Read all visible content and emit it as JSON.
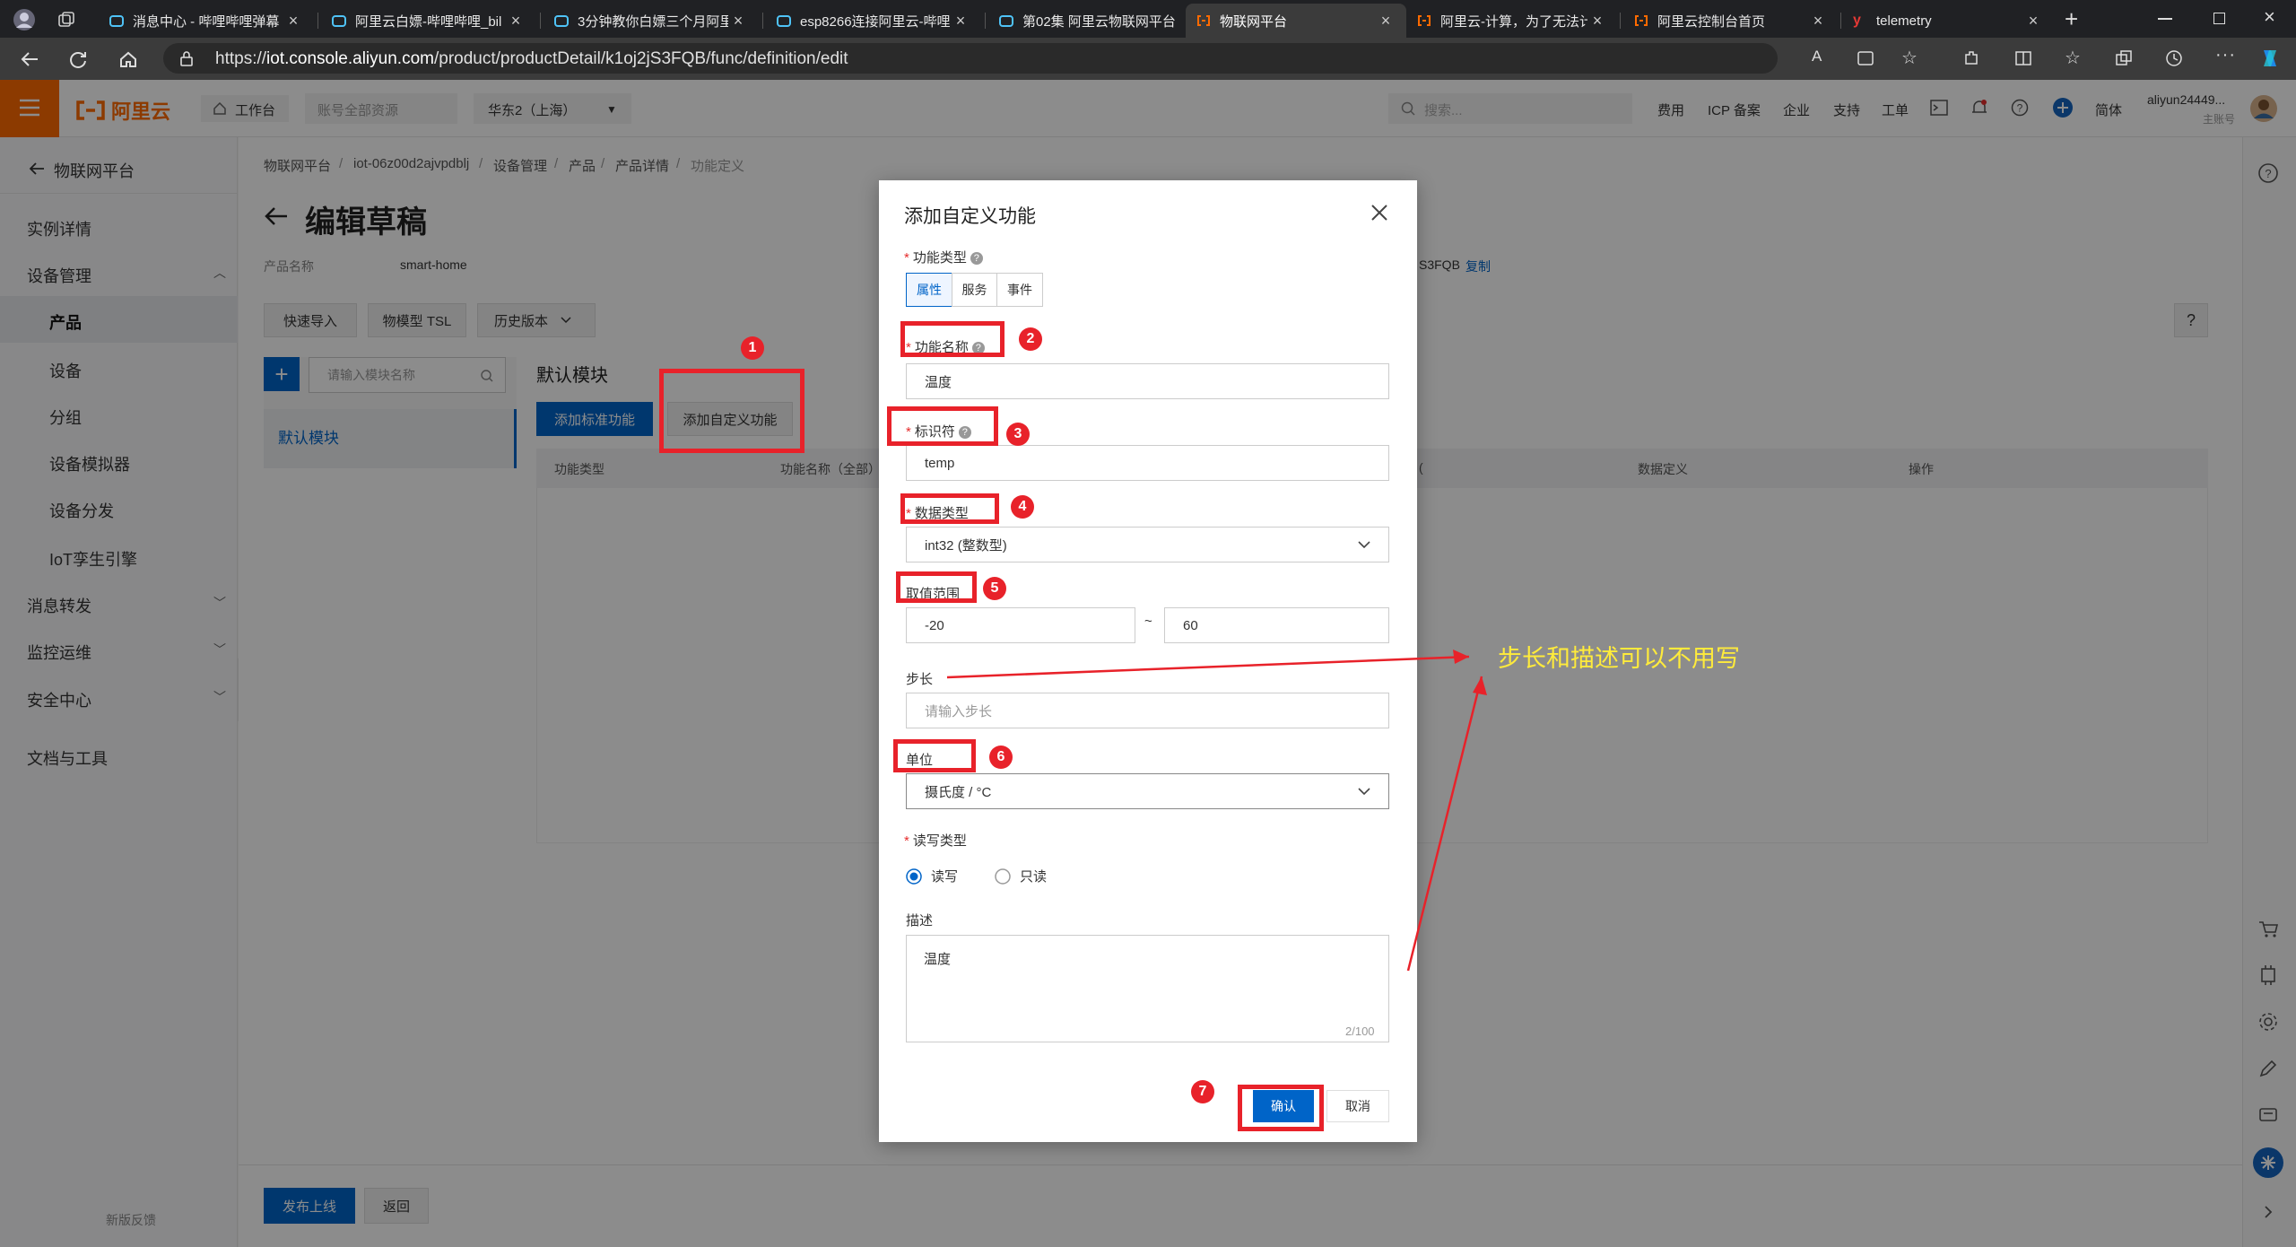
{
  "browser": {
    "tabs": [
      {
        "title": "消息中心 - 哔哩哔哩弹幕"
      },
      {
        "title": "阿里云白嫖-哔哩哔哩_bil"
      },
      {
        "title": "3分钟教你白嫖三个月阿里"
      },
      {
        "title": "esp8266连接阿里云-哔哩"
      },
      {
        "title": "第02集 阿里云物联网平台"
      },
      {
        "title": "物联网平台"
      },
      {
        "title": "阿里云-计算，为了无法计"
      },
      {
        "title": "阿里云控制台首页"
      },
      {
        "title": "telemetry"
      }
    ],
    "url_prefix": "https://",
    "url_host": "iot.console.aliyun.com",
    "url_path": "/product/productDetail/k1oj2jS3FQB/func/definition/edit"
  },
  "topnav": {
    "logo_text": "阿里云",
    "workbench": "工作台",
    "account_scope": "账号全部资源",
    "region": "华东2（上海）",
    "search_placeholder": "搜索...",
    "links": [
      "费用",
      "ICP 备案",
      "企业",
      "支持",
      "工单"
    ],
    "lang": "简体",
    "user_name": "aliyun24449...",
    "user_role": "主账号"
  },
  "sidebar": {
    "back_title": "物联网平台",
    "items": [
      {
        "label": "实例详情"
      },
      {
        "label": "设备管理"
      },
      {
        "label": "产品"
      },
      {
        "label": "设备"
      },
      {
        "label": "分组"
      },
      {
        "label": "设备模拟器"
      },
      {
        "label": "设备分发"
      },
      {
        "label": "IoT孪生引擎"
      },
      {
        "label": "消息转发"
      },
      {
        "label": "监控运维"
      },
      {
        "label": "安全中心"
      },
      {
        "label": "文档与工具"
      }
    ],
    "feedback": "新版反馈"
  },
  "breadcrumb": [
    "物联网平台",
    "iot-06z00d2ajvpdblj",
    "设备管理",
    "产品",
    "产品详情",
    "功能定义"
  ],
  "page": {
    "title": "编辑草稿",
    "product_name_label": "产品名称",
    "product_name_value": "smart-home",
    "product_key_partial": "S3FQB",
    "copy_link": "复制",
    "quick_import": "快速导入",
    "tsl_model": "物模型 TSL",
    "history_version": "历史版本",
    "module_search_placeholder": "请输入模块名称",
    "default_module_nav": "默认模块",
    "default_module_title": "默认模块",
    "add_standard": "添加标准功能",
    "add_custom": "添加自定义功能",
    "table_headers": [
      "功能类型",
      "功能名称（全部）",
      "数据定义",
      "操作"
    ],
    "table_header_partial": "(",
    "publish": "发布上线",
    "back": "返回",
    "help_mark": "?"
  },
  "modal": {
    "title": "添加自定义功能",
    "func_type_label": "功能类型",
    "func_types": [
      "属性",
      "服务",
      "事件"
    ],
    "selected_func_type": "属性",
    "func_name_label": "功能名称",
    "func_name_value": "温度",
    "identifier_label": "标识符",
    "identifier_value": "temp",
    "data_type_label": "数据类型",
    "data_type_value": "int32 (整数型)",
    "range_label": "取值范围",
    "range_min": "-20",
    "range_sep": "~",
    "range_max": "60",
    "step_label": "步长",
    "step_placeholder": "请输入步长",
    "unit_label": "单位",
    "unit_value": "摄氏度 / °C",
    "rw_label": "读写类型",
    "rw_options": [
      "读写",
      "只读"
    ],
    "rw_selected": "读写",
    "desc_label": "描述",
    "desc_value": "温度",
    "desc_counter": "2/100",
    "confirm": "确认",
    "cancel": "取消"
  },
  "annotations": {
    "markers": [
      "1",
      "2",
      "3",
      "4",
      "5",
      "6",
      "7"
    ],
    "note": "步长和描述可以不用写",
    "color": "#e8222a",
    "note_color": "#ffeb3b"
  }
}
